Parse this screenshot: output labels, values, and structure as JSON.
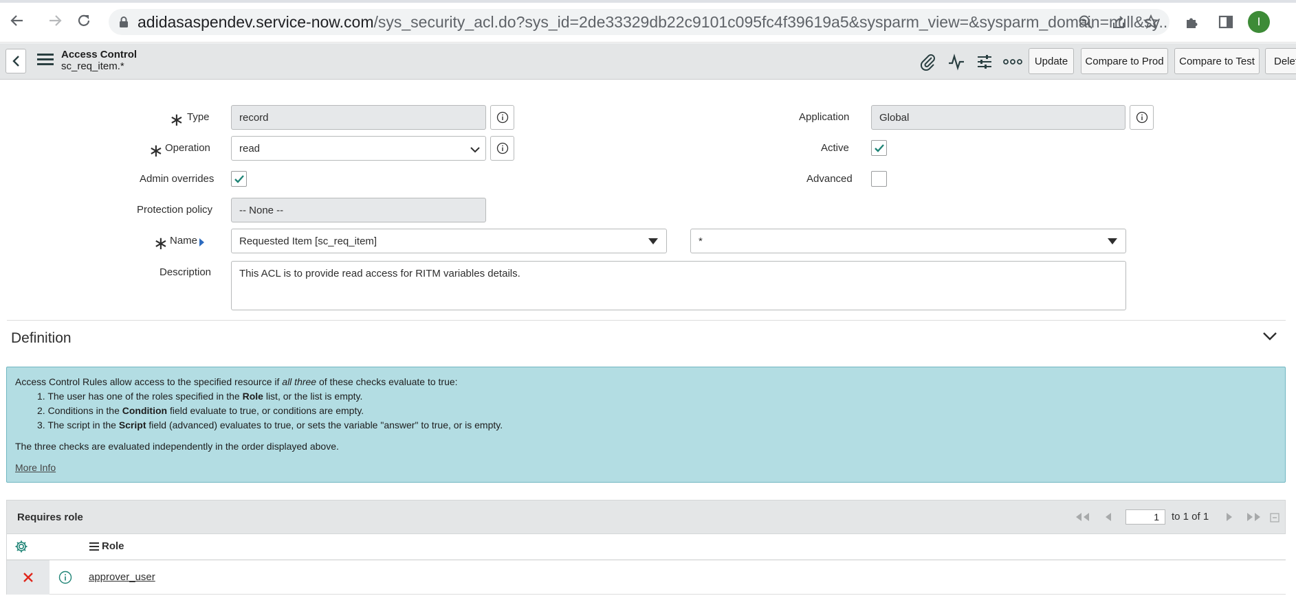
{
  "browser": {
    "url_host": "adidasaspendev.service-now.com",
    "url_path": "/sys_security_acl.do?sys_id=2de33329db22c9101c095fc4f39619a5&sysparm_view=&sysparm_domain=null&sy...",
    "avatar_letter": "I"
  },
  "header": {
    "title": "Access Control",
    "subtitle": "sc_req_item.*",
    "buttons": [
      "Update",
      "Compare to Prod",
      "Compare to Test",
      "Delete"
    ]
  },
  "form": {
    "type_label": "Type",
    "type_value": "record",
    "operation_label": "Operation",
    "operation_value": "read",
    "admin_overrides_label": "Admin overrides",
    "admin_overrides_checked": true,
    "protection_policy_label": "Protection policy",
    "protection_policy_value": "-- None --",
    "name_label": "Name",
    "name_table_value": "Requested Item [sc_req_item]",
    "name_field_value": "*",
    "description_label": "Description",
    "description_value": "This ACL is to provide read access for RITM variables details.",
    "application_label": "Application",
    "application_value": "Global",
    "active_label": "Active",
    "active_checked": true,
    "advanced_label": "Advanced",
    "advanced_checked": false
  },
  "definition": {
    "title": "Definition",
    "intro_a": "Access Control Rules allow access to the specified resource if ",
    "intro_em": "all three",
    "intro_b": " of these checks evaluate to true:",
    "item1_a": "1. The user has one of the roles specified in the ",
    "item1_b": "Role",
    "item1_c": " list, or the list is empty.",
    "item2_a": "2. Conditions in the ",
    "item2_b": "Condition",
    "item2_c": " field evaluate to true, or conditions are empty.",
    "item3_a": "3. The script in the ",
    "item3_b": "Script",
    "item3_c": " field (advanced) evaluates to true, or sets the variable \"answer\" to true, or is empty.",
    "note": "The three checks are evaluated independently in the order displayed above.",
    "more_info": "More Info"
  },
  "related_list": {
    "title": "Requires role",
    "page_value": "1",
    "page_text": "to 1 of 1",
    "column_role": "Role",
    "rows": [
      {
        "role": "approver_user"
      }
    ]
  },
  "colors": {
    "info_bg": "#b3dde3",
    "check_green": "#1f8476",
    "delete_red": "#e0261b",
    "avatar_green": "#3d8b37"
  }
}
